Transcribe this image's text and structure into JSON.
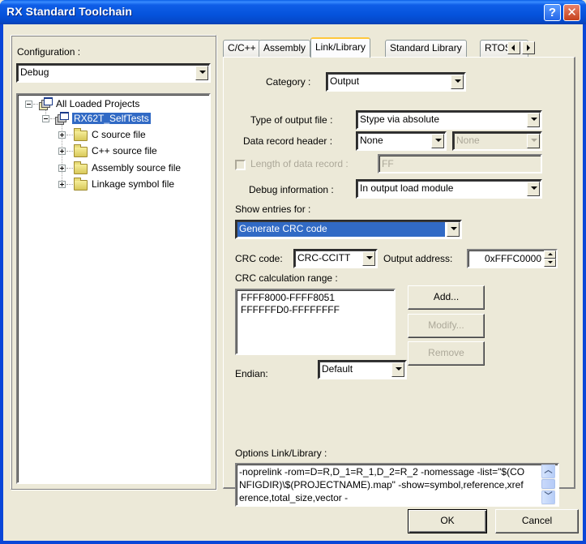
{
  "window": {
    "title": "RX Standard Toolchain",
    "help_label": "?",
    "close_label": "✕"
  },
  "left": {
    "configuration_label": "Configuration :",
    "configuration_value": "Debug",
    "tree": {
      "root": "All Loaded Projects",
      "project": "RX62T_SelfTests",
      "folders": [
        "C source file",
        "C++ source file",
        "Assembly source file",
        "Linkage symbol file"
      ]
    },
    "hscroll_left": "‹",
    "hscroll_right": "›",
    "hscroll_grip": "IIII"
  },
  "tabs": {
    "items": [
      "C/C++",
      "Assembly",
      "Link/Library",
      "Standard Library",
      "RTOS"
    ],
    "active": "Link/Library"
  },
  "panel": {
    "category_label": "Category :",
    "category_value": "Output",
    "output_type_label": "Type of output file :",
    "output_type_value": "Stype via absolute",
    "data_record_header_label": "Data record header :",
    "data_record_header_value": "None",
    "data_record_header_value2": "None",
    "length_label": "Length of data record :",
    "length_value": "FF",
    "length_checked": false,
    "debug_info_label": "Debug information :",
    "debug_info_value": "In output load module",
    "show_entries_label": "Show entries for :",
    "show_entries_value": "Generate CRC code",
    "crc_code_label": "CRC code:",
    "crc_code_value": "CRC-CCITT",
    "output_address_label": "Output address:",
    "output_address_value": "0xFFFC0000",
    "crc_range_label": "CRC calculation range :",
    "crc_ranges": [
      "FFFF8000-FFFF8051",
      "FFFFFFD0-FFFFFFFF"
    ],
    "add_label": "Add...",
    "modify_label": "Modify...",
    "remove_label": "Remove",
    "endian_label": "Endian:",
    "endian_value": "Default",
    "options_label": "Options Link/Library :",
    "options_text": "-noprelink -rom=D=R,D_1=R_1,D_2=R_2 -nomessage -list=\"$(CONFIGDIR)\\$(PROJECTNAME).map\" -show=symbol,reference,xreference,total_size,vector -"
  },
  "footer": {
    "ok_label": "OK",
    "cancel_label": "Cancel"
  },
  "colors": {
    "titlebar": "#0553dc",
    "selection": "#316ac5",
    "dialog_bg": "#ece9d8",
    "active_tab_accent": "#ffc83c"
  }
}
